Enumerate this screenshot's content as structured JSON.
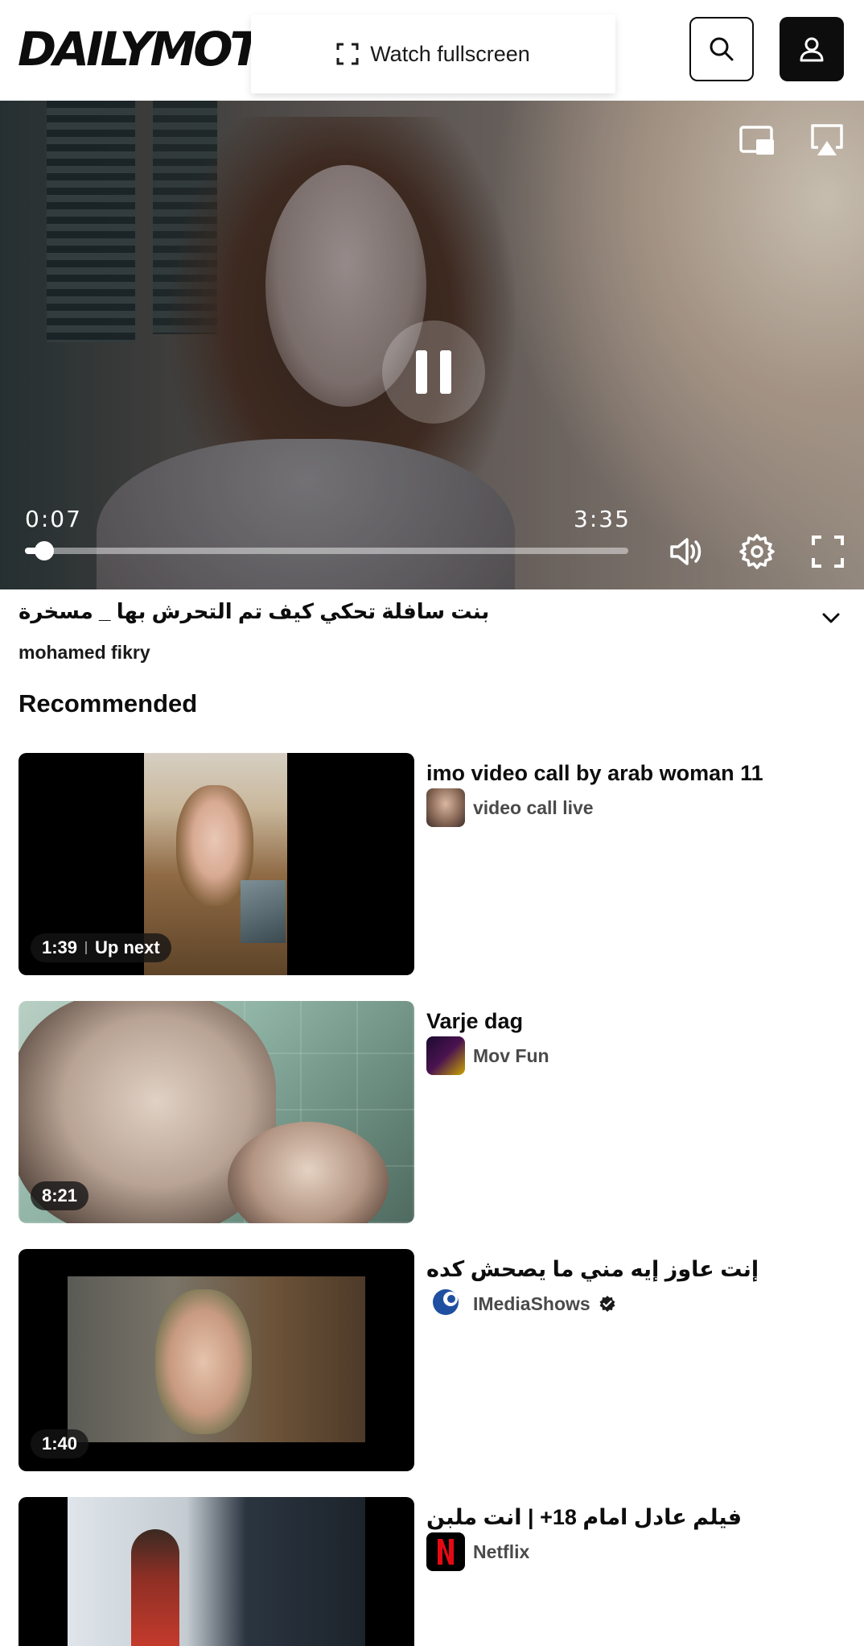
{
  "header": {
    "logo_text": "DAILYMOTION",
    "fullscreen_banner_label": "Watch fullscreen"
  },
  "player": {
    "current_time": "0:07",
    "duration": "3:35",
    "progress_fraction": 0.0325
  },
  "video": {
    "title": "بنت سافلة تحكي كيف تم التحرش بها _ مسخرة",
    "channel": "mohamed fikry"
  },
  "recommended": {
    "heading": "Recommended",
    "items": [
      {
        "title": "imo video call by arab woman 11",
        "channel": "video call live",
        "duration": "1:39",
        "up_next": "Up next",
        "verified": false
      },
      {
        "title": "Varje dag",
        "channel": "Mov Fun",
        "duration": "8:21",
        "verified": false
      },
      {
        "title": "إنت عاوز إيه مني ما يصحش كده",
        "channel": "IMediaShows",
        "duration": "1:40",
        "verified": true
      },
      {
        "title": "فيلم عادل امام 18+ | انت ملبن",
        "channel": "Netflix",
        "duration": "",
        "verified": false
      }
    ]
  },
  "colors": {
    "text": "#0d0d0d",
    "secondary_text": "#4a4a4a",
    "netflix_red": "#e50914"
  }
}
